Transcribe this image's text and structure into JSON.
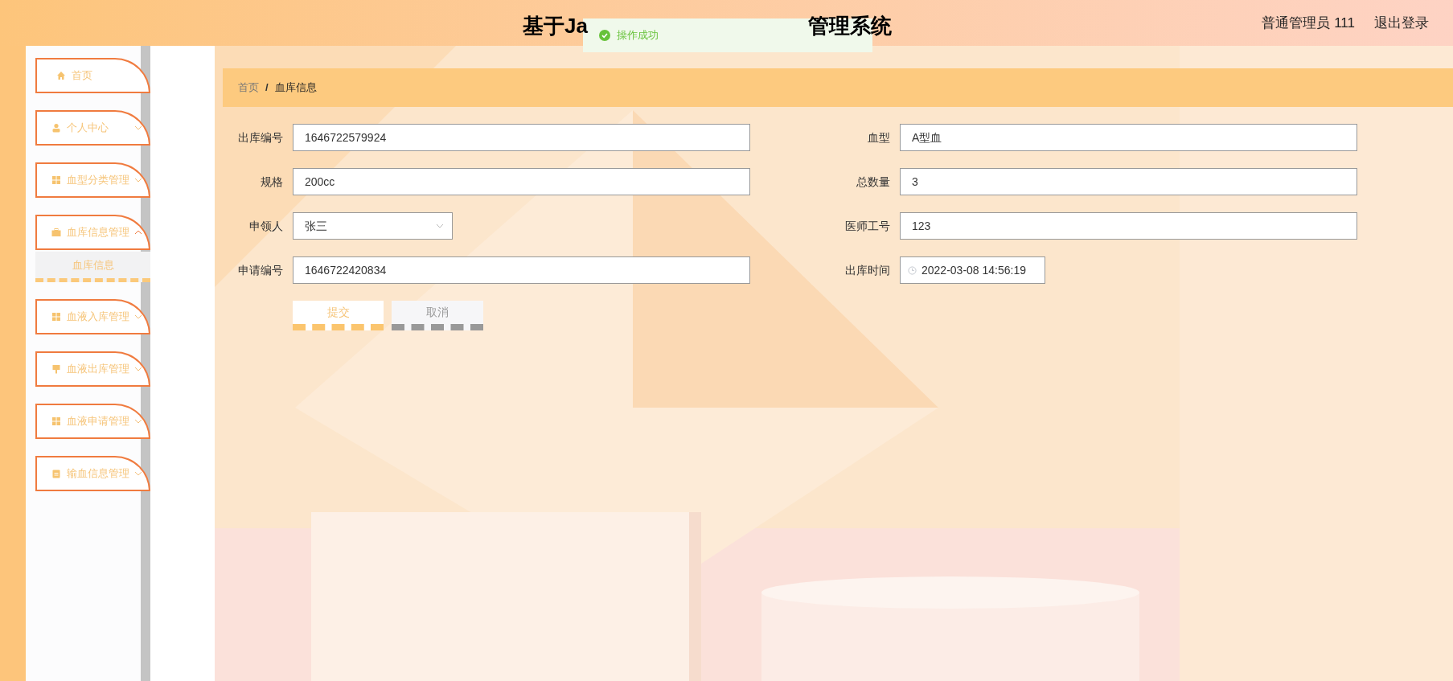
{
  "header": {
    "title_parts": [
      "基于Ja",
      "管理系统"
    ],
    "user": "普通管理员 111",
    "logout": "退出登录"
  },
  "toast": {
    "message": "操作成功"
  },
  "sidebar": {
    "items": [
      {
        "label": "首页",
        "kind": "link"
      },
      {
        "label": "个人中心",
        "kind": "submenu",
        "expanded": false
      },
      {
        "label": "血型分类管理",
        "kind": "submenu",
        "expanded": false
      },
      {
        "label": "血库信息管理",
        "kind": "submenu",
        "expanded": true,
        "children": [
          {
            "label": "血库信息",
            "selected": true
          }
        ]
      },
      {
        "label": "血液入库管理",
        "kind": "submenu",
        "expanded": false
      },
      {
        "label": "血液出库管理",
        "kind": "submenu",
        "expanded": false
      },
      {
        "label": "血液申请管理",
        "kind": "submenu",
        "expanded": false
      },
      {
        "label": "输血信息管理",
        "kind": "submenu",
        "expanded": false
      }
    ]
  },
  "breadcrumb": {
    "items": [
      "首页",
      "血库信息"
    ],
    "separator": "/"
  },
  "form": {
    "fields": [
      {
        "label": "出库编号",
        "value": "1646722579924",
        "kind": "text"
      },
      {
        "label": "血型",
        "value": "A型血",
        "kind": "text"
      },
      {
        "label": "规格",
        "value": "200cc",
        "kind": "text"
      },
      {
        "label": "总数量",
        "value": "3",
        "kind": "text"
      },
      {
        "label": "申领人",
        "value": "张三",
        "kind": "select"
      },
      {
        "label": "医师工号",
        "value": "123",
        "kind": "text"
      },
      {
        "label": "申请编号",
        "value": "1646722420834",
        "kind": "text"
      },
      {
        "label": "出库时间",
        "value": "2022-03-08 14:56:19",
        "kind": "datetime"
      }
    ],
    "buttons": [
      {
        "label": "提交",
        "kind": "primary"
      },
      {
        "label": "取消",
        "kind": "secondary"
      }
    ]
  }
}
